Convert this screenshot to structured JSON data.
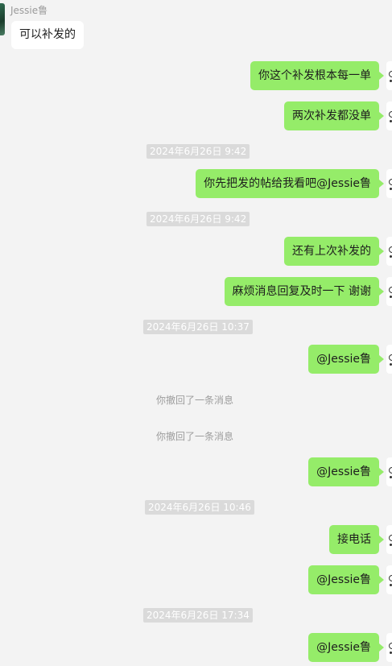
{
  "colors": {
    "background": "#f3f3f3",
    "outgoing_bubble": "#95ec69",
    "incoming_bubble": "#ffffff",
    "timestamp_bg": "#dadada"
  },
  "incoming": {
    "sender": "Jessie鲁",
    "message": "可以补发的"
  },
  "messages": [
    {
      "type": "out",
      "text": "你这个补发根本每一单"
    },
    {
      "type": "out",
      "text": "两次补发都没单"
    },
    {
      "type": "time",
      "text": "2024年6月26日 9:42"
    },
    {
      "type": "out",
      "text": "你先把发的帖给我看吧@Jessie鲁"
    },
    {
      "type": "time",
      "text": "2024年6月26日 9:42"
    },
    {
      "type": "out",
      "text": "还有上次补发的"
    },
    {
      "type": "out",
      "text": "麻烦消息回复及时一下 谢谢"
    },
    {
      "type": "time",
      "text": "2024年6月26日 10:37"
    },
    {
      "type": "out",
      "text": "@Jessie鲁"
    },
    {
      "type": "system",
      "text": "你撤回了一条消息"
    },
    {
      "type": "system",
      "text": "你撤回了一条消息"
    },
    {
      "type": "out",
      "text": "@Jessie鲁"
    },
    {
      "type": "time",
      "text": "2024年6月26日 10:46"
    },
    {
      "type": "out",
      "text": "接电话"
    },
    {
      "type": "out",
      "text": "@Jessie鲁"
    },
    {
      "type": "time",
      "text": "2024年6月26日 17:34"
    },
    {
      "type": "out",
      "text": "@Jessie鲁"
    }
  ]
}
